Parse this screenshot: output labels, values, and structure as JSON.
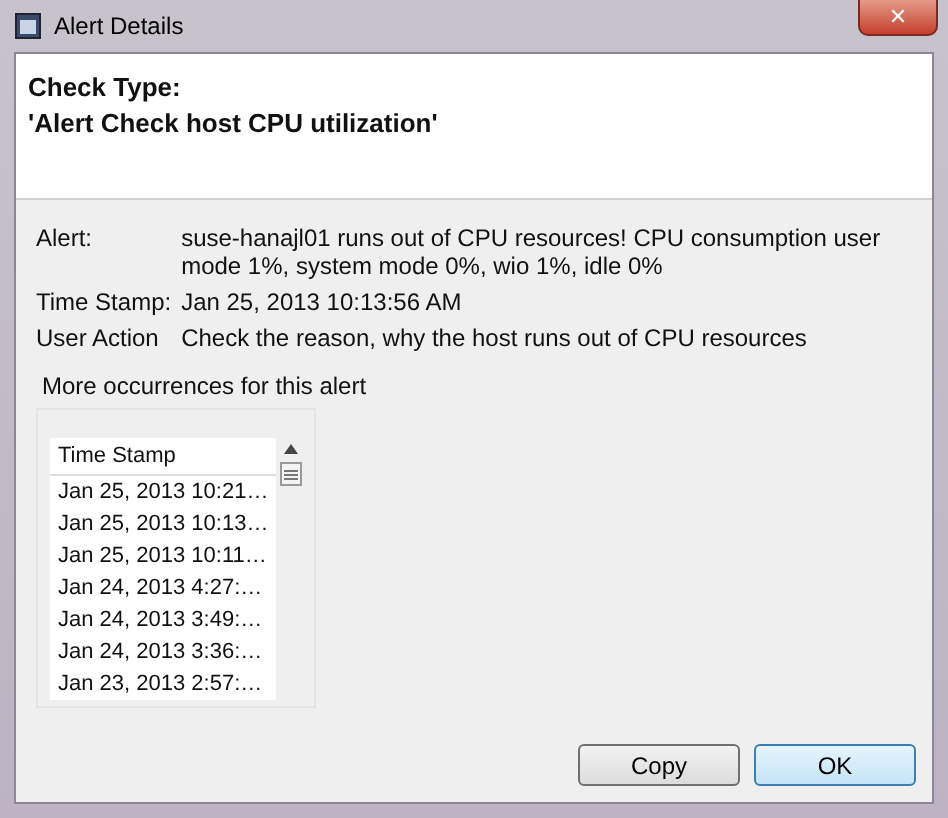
{
  "window": {
    "title": "Alert Details",
    "close": "✕"
  },
  "header": {
    "label": "Check Type:",
    "value": "'Alert Check host CPU utilization'"
  },
  "details": [
    {
      "label": "Alert:",
      "value": "suse-hanajl01 runs out of CPU resources! CPU consumption user mode 1%, system mode 0%, wio 1%, idle 0%"
    },
    {
      "label": "Time Stamp:",
      "value": "Jan 25, 2013 10:13:56 AM"
    },
    {
      "label": "User Action",
      "value": "Check the reason, why the host runs out of CPU resources"
    }
  ],
  "occurrences": {
    "title": "More occurrences for this alert",
    "columns": [
      "Time Stamp"
    ],
    "rows": [
      "Jan 25, 2013 10:21…",
      "Jan 25, 2013 10:13…",
      "Jan 25, 2013 10:11…",
      "Jan 24, 2013 4:27:…",
      "Jan 24, 2013 3:49:…",
      "Jan 24, 2013 3:36:…",
      "Jan 23, 2013 2:57:…"
    ]
  },
  "buttons": [
    {
      "label": "Copy",
      "default": false
    },
    {
      "label": "OK",
      "default": true
    }
  ]
}
